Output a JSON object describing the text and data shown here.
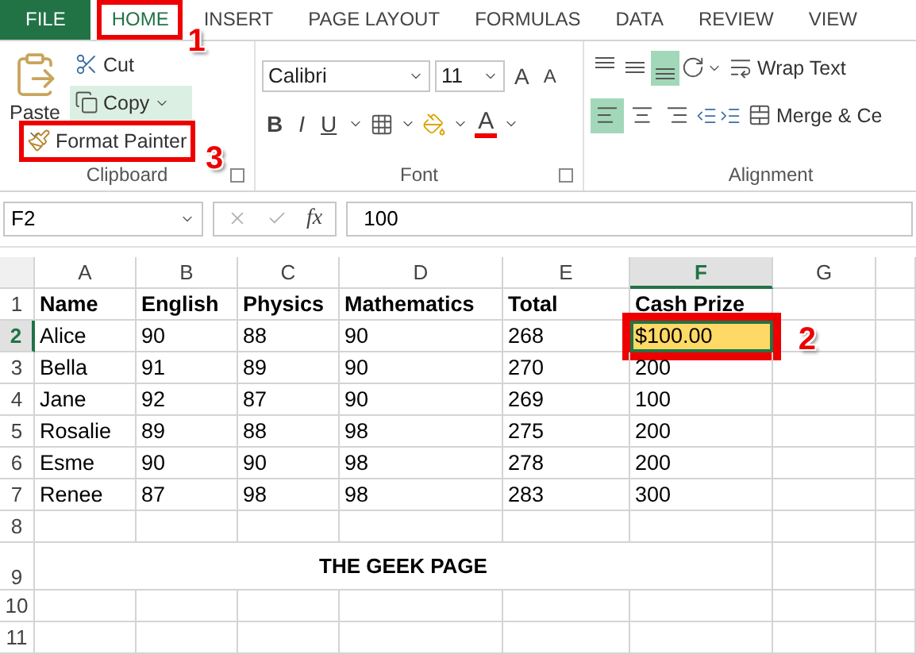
{
  "tabs": [
    {
      "label": "FILE",
      "kind": "file",
      "selected": false
    },
    {
      "label": "HOME",
      "kind": "tab",
      "selected": true,
      "callout": "1"
    },
    {
      "label": "INSERT",
      "kind": "tab",
      "selected": false
    },
    {
      "label": "PAGE LAYOUT",
      "kind": "tab",
      "selected": false
    },
    {
      "label": "FORMULAS",
      "kind": "tab",
      "selected": false
    },
    {
      "label": "DATA",
      "kind": "tab",
      "selected": false
    },
    {
      "label": "REVIEW",
      "kind": "tab",
      "selected": false
    },
    {
      "label": "VIEW",
      "kind": "tab",
      "selected": false
    }
  ],
  "clipboard": {
    "paste": "Paste",
    "cut": "Cut",
    "copy": "Copy",
    "format_painter": {
      "label": "Format Painter",
      "callout": "3"
    },
    "label": "Clipboard"
  },
  "font": {
    "name": "Calibri",
    "size": "11",
    "grow": "A",
    "shrink": "A",
    "bold": "B",
    "italic": "I",
    "underline": "U",
    "font_color": "A",
    "label": "Font"
  },
  "alignment": {
    "vertical": [
      {
        "selected": false
      },
      {
        "selected": false
      },
      {
        "selected": true
      }
    ],
    "horizontal": [
      {
        "selected": true
      },
      {
        "selected": false
      },
      {
        "selected": false
      }
    ],
    "wrap_text": "Wrap Text",
    "merge": "Merge & Ce",
    "label": "Alignment"
  },
  "formula_bar": {
    "name_box": "F2",
    "fx": "fx",
    "value": "100"
  },
  "sheet": {
    "columns": [
      {
        "label": "A",
        "selected": false
      },
      {
        "label": "B",
        "selected": false
      },
      {
        "label": "C",
        "selected": false
      },
      {
        "label": "D",
        "selected": false
      },
      {
        "label": "E",
        "selected": false
      },
      {
        "label": "F",
        "selected": true
      },
      {
        "label": "G",
        "selected": false
      }
    ],
    "rows": [
      {
        "number": "1",
        "selected": false,
        "kind": "header",
        "cells": [
          {
            "text": "Name",
            "selected": false
          },
          {
            "text": "English",
            "selected": false
          },
          {
            "text": "Physics",
            "selected": false
          },
          {
            "text": "Mathematics",
            "selected": false
          },
          {
            "text": "Total",
            "selected": false
          },
          {
            "text": "Cash Prize",
            "selected": false
          }
        ]
      },
      {
        "number": "2",
        "selected": true,
        "kind": "data",
        "cells": [
          {
            "text": "Alice",
            "selected": false
          },
          {
            "text": "90",
            "selected": false
          },
          {
            "text": "88",
            "selected": false
          },
          {
            "text": "90",
            "selected": false
          },
          {
            "text": "268",
            "selected": false
          },
          {
            "text": "$100.00",
            "selected": true,
            "color": "#ffd966",
            "callout": "2"
          }
        ]
      },
      {
        "number": "3",
        "selected": false,
        "kind": "data",
        "cells": [
          {
            "text": "Bella",
            "selected": false
          },
          {
            "text": "91",
            "selected": false
          },
          {
            "text": "89",
            "selected": false
          },
          {
            "text": "90",
            "selected": false
          },
          {
            "text": "270",
            "selected": false
          },
          {
            "text": "200",
            "selected": false
          }
        ]
      },
      {
        "number": "4",
        "selected": false,
        "kind": "data",
        "cells": [
          {
            "text": "Jane",
            "selected": false
          },
          {
            "text": "92",
            "selected": false
          },
          {
            "text": "87",
            "selected": false
          },
          {
            "text": "90",
            "selected": false
          },
          {
            "text": "269",
            "selected": false
          },
          {
            "text": "100",
            "selected": false
          }
        ]
      },
      {
        "number": "5",
        "selected": false,
        "kind": "data",
        "cells": [
          {
            "text": "Rosalie",
            "selected": false
          },
          {
            "text": "89",
            "selected": false
          },
          {
            "text": "88",
            "selected": false
          },
          {
            "text": "98",
            "selected": false
          },
          {
            "text": "275",
            "selected": false
          },
          {
            "text": "200",
            "selected": false
          }
        ]
      },
      {
        "number": "6",
        "selected": false,
        "kind": "data",
        "cells": [
          {
            "text": "Esme",
            "selected": false
          },
          {
            "text": "90",
            "selected": false
          },
          {
            "text": "90",
            "selected": false
          },
          {
            "text": "98",
            "selected": false
          },
          {
            "text": "278",
            "selected": false
          },
          {
            "text": "200",
            "selected": false
          }
        ]
      },
      {
        "number": "7",
        "selected": false,
        "kind": "data",
        "cells": [
          {
            "text": "Renee",
            "selected": false
          },
          {
            "text": "87",
            "selected": false
          },
          {
            "text": "98",
            "selected": false
          },
          {
            "text": "98",
            "selected": false
          },
          {
            "text": "283",
            "selected": false
          },
          {
            "text": "300",
            "selected": false
          }
        ]
      },
      {
        "number": "8",
        "selected": false,
        "kind": "blank"
      },
      {
        "number": "9",
        "selected": false,
        "kind": "title",
        "merged": "THE GEEK PAGE"
      },
      {
        "number": "10",
        "selected": false,
        "kind": "blank"
      },
      {
        "number": "11",
        "selected": false,
        "kind": "blank"
      }
    ]
  }
}
